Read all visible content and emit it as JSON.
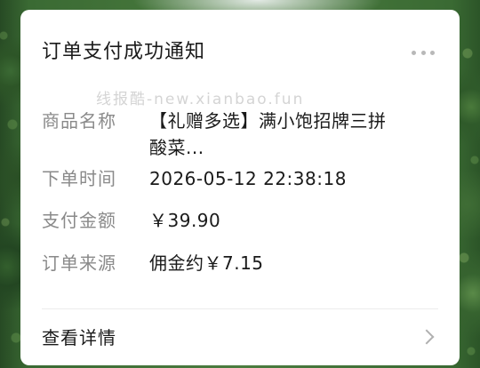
{
  "card": {
    "title": "订单支付成功通知",
    "more_icon": "more-horizontal-icon",
    "watermark": "线报酷-new.xianbao.fun",
    "fields": {
      "product": {
        "label": "商品名称",
        "value": "【礼赠多选】满小饱招牌三拼酸菜..."
      },
      "order_time": {
        "label": "下单时间",
        "value": "2026-05-12 22:38:18"
      },
      "amount": {
        "label": "支付金额",
        "value": "￥39.90"
      },
      "source": {
        "label": "订单来源",
        "value": "佣金约￥7.15"
      }
    },
    "details": {
      "label": "查看详情",
      "icon": "chevron-right-icon"
    }
  }
}
